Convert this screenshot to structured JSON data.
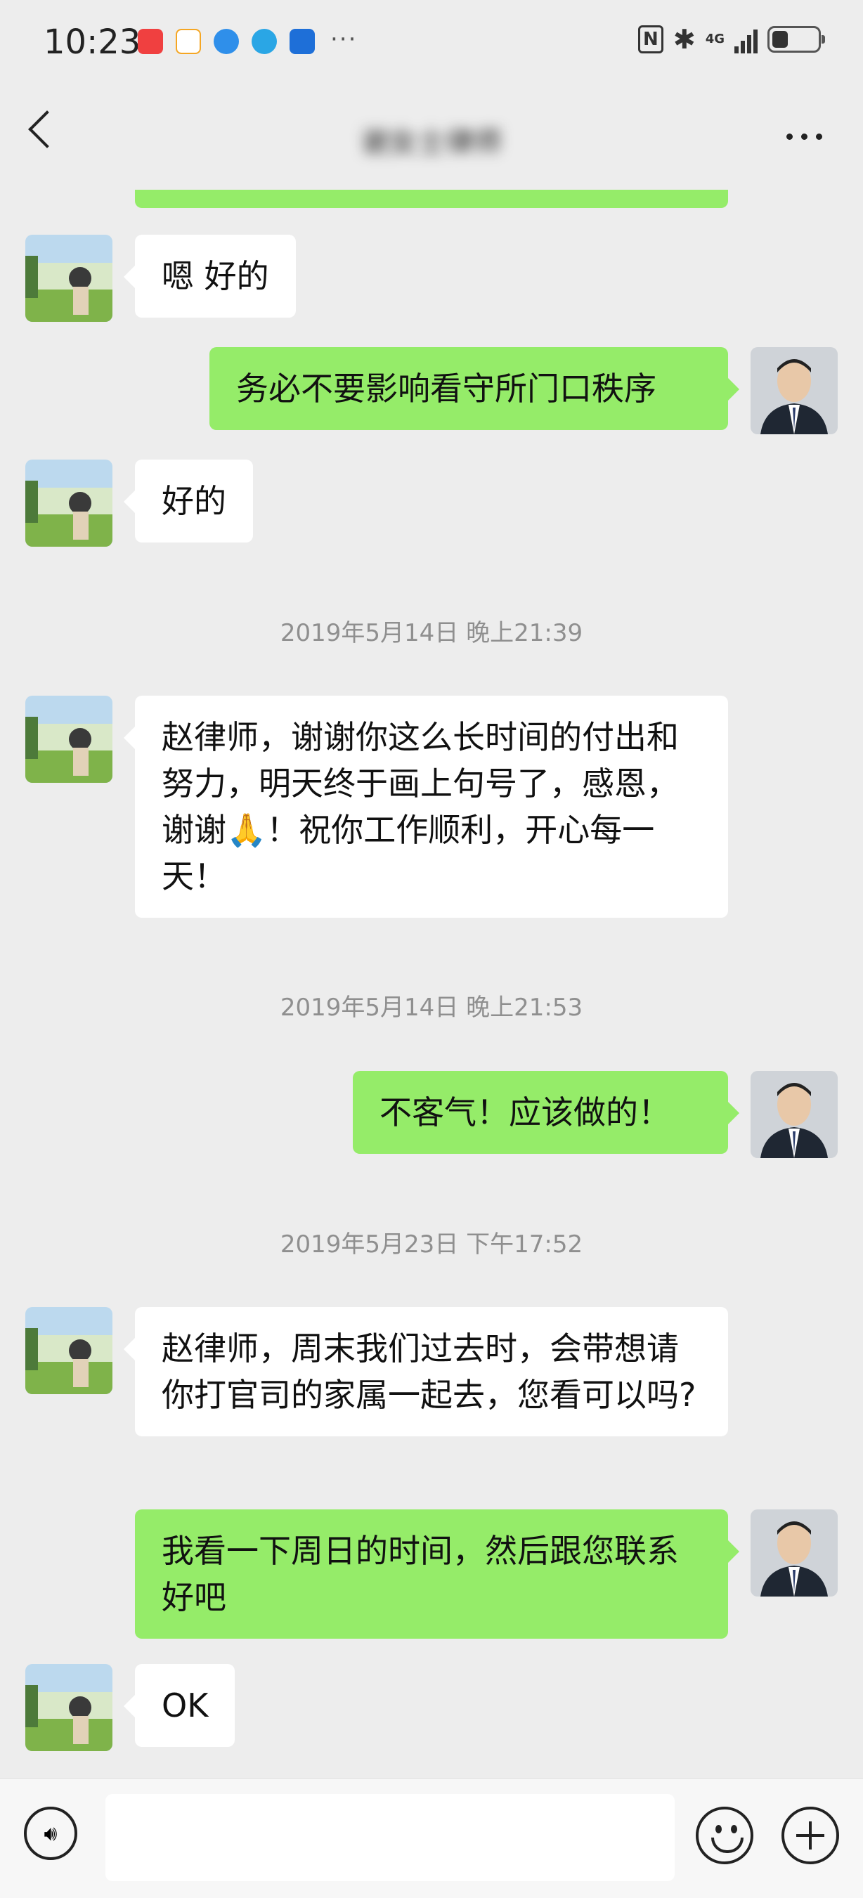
{
  "status_bar": {
    "time": "10:23",
    "app_icons": [
      {
        "name": "huawei-app-icon",
        "color": "#f04040"
      },
      {
        "name": "xiaomei-app-icon",
        "color": "#f5a623"
      },
      {
        "name": "messenger-app-icon",
        "color": "#2f8fea"
      },
      {
        "name": "browser-app-icon",
        "color": "#2aa6e5"
      },
      {
        "name": "weather-app-icon",
        "color": "#1e6fd8"
      }
    ],
    "more_label": "···",
    "network": "4G",
    "nfc_label": "N",
    "battery_level_percent": 35
  },
  "header": {
    "title": "谢女士律师"
  },
  "messages": [
    {
      "type": "outgoing",
      "text": ""
    },
    {
      "type": "incoming",
      "text": "嗯 好的"
    },
    {
      "type": "outgoing",
      "text": "务必不要影响看守所门口秩序"
    },
    {
      "type": "incoming",
      "text": "好的"
    },
    {
      "type": "timestamp",
      "text": "2019年5月14日 晚上21:39"
    },
    {
      "type": "incoming",
      "text": "赵律师，谢谢你这么长时间的付出和努力，明天终于画上句号了，感恩，谢谢🙏！祝你工作顺利，开心每一天！"
    },
    {
      "type": "timestamp",
      "text": "2019年5月14日 晚上21:53"
    },
    {
      "type": "outgoing",
      "text": "不客气！应该做的！"
    },
    {
      "type": "timestamp",
      "text": "2019年5月23日 下午17:52"
    },
    {
      "type": "incoming",
      "text": "赵律师，周末我们过去时，会带想请你打官司的家属一起去，您看可以吗?"
    },
    {
      "type": "outgoing",
      "text": "我看一下周日的时间，然后跟您联系好吧"
    },
    {
      "type": "incoming",
      "text": "OK"
    }
  ],
  "colors": {
    "outgoing_bubble": "#95ec69",
    "incoming_bubble": "#ffffff",
    "background": "#ededed"
  }
}
